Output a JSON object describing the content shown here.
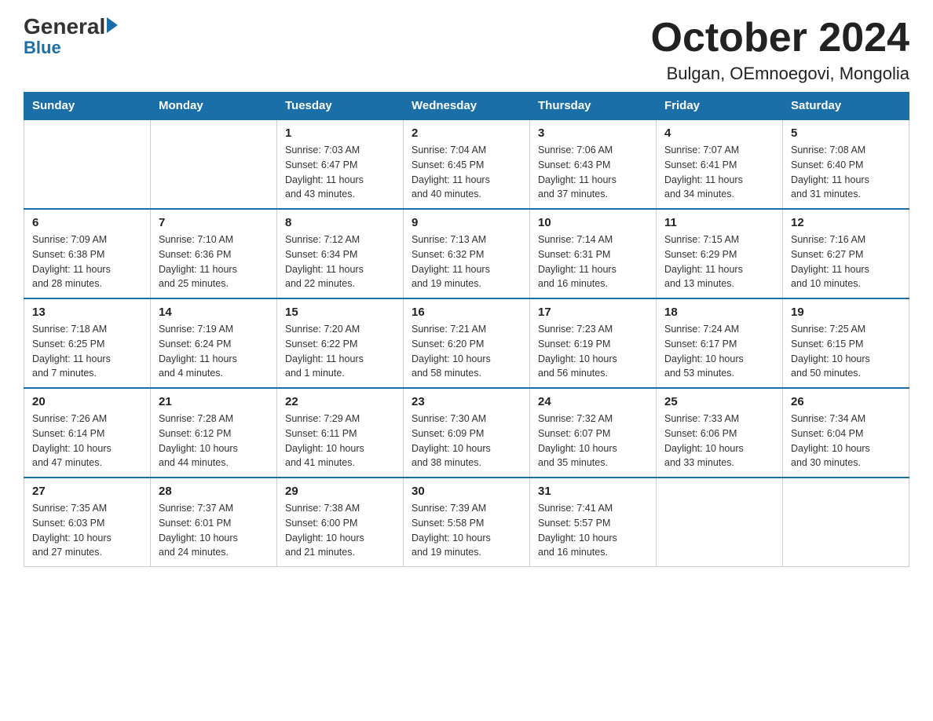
{
  "logo": {
    "general": "General",
    "blue": "Blue"
  },
  "header": {
    "title": "October 2024",
    "subtitle": "Bulgan, OEmnoegovi, Mongolia"
  },
  "days_of_week": [
    "Sunday",
    "Monday",
    "Tuesday",
    "Wednesday",
    "Thursday",
    "Friday",
    "Saturday"
  ],
  "weeks": [
    [
      {
        "day": "",
        "info": ""
      },
      {
        "day": "",
        "info": ""
      },
      {
        "day": "1",
        "info": "Sunrise: 7:03 AM\nSunset: 6:47 PM\nDaylight: 11 hours\nand 43 minutes."
      },
      {
        "day": "2",
        "info": "Sunrise: 7:04 AM\nSunset: 6:45 PM\nDaylight: 11 hours\nand 40 minutes."
      },
      {
        "day": "3",
        "info": "Sunrise: 7:06 AM\nSunset: 6:43 PM\nDaylight: 11 hours\nand 37 minutes."
      },
      {
        "day": "4",
        "info": "Sunrise: 7:07 AM\nSunset: 6:41 PM\nDaylight: 11 hours\nand 34 minutes."
      },
      {
        "day": "5",
        "info": "Sunrise: 7:08 AM\nSunset: 6:40 PM\nDaylight: 11 hours\nand 31 minutes."
      }
    ],
    [
      {
        "day": "6",
        "info": "Sunrise: 7:09 AM\nSunset: 6:38 PM\nDaylight: 11 hours\nand 28 minutes."
      },
      {
        "day": "7",
        "info": "Sunrise: 7:10 AM\nSunset: 6:36 PM\nDaylight: 11 hours\nand 25 minutes."
      },
      {
        "day": "8",
        "info": "Sunrise: 7:12 AM\nSunset: 6:34 PM\nDaylight: 11 hours\nand 22 minutes."
      },
      {
        "day": "9",
        "info": "Sunrise: 7:13 AM\nSunset: 6:32 PM\nDaylight: 11 hours\nand 19 minutes."
      },
      {
        "day": "10",
        "info": "Sunrise: 7:14 AM\nSunset: 6:31 PM\nDaylight: 11 hours\nand 16 minutes."
      },
      {
        "day": "11",
        "info": "Sunrise: 7:15 AM\nSunset: 6:29 PM\nDaylight: 11 hours\nand 13 minutes."
      },
      {
        "day": "12",
        "info": "Sunrise: 7:16 AM\nSunset: 6:27 PM\nDaylight: 11 hours\nand 10 minutes."
      }
    ],
    [
      {
        "day": "13",
        "info": "Sunrise: 7:18 AM\nSunset: 6:25 PM\nDaylight: 11 hours\nand 7 minutes."
      },
      {
        "day": "14",
        "info": "Sunrise: 7:19 AM\nSunset: 6:24 PM\nDaylight: 11 hours\nand 4 minutes."
      },
      {
        "day": "15",
        "info": "Sunrise: 7:20 AM\nSunset: 6:22 PM\nDaylight: 11 hours\nand 1 minute."
      },
      {
        "day": "16",
        "info": "Sunrise: 7:21 AM\nSunset: 6:20 PM\nDaylight: 10 hours\nand 58 minutes."
      },
      {
        "day": "17",
        "info": "Sunrise: 7:23 AM\nSunset: 6:19 PM\nDaylight: 10 hours\nand 56 minutes."
      },
      {
        "day": "18",
        "info": "Sunrise: 7:24 AM\nSunset: 6:17 PM\nDaylight: 10 hours\nand 53 minutes."
      },
      {
        "day": "19",
        "info": "Sunrise: 7:25 AM\nSunset: 6:15 PM\nDaylight: 10 hours\nand 50 minutes."
      }
    ],
    [
      {
        "day": "20",
        "info": "Sunrise: 7:26 AM\nSunset: 6:14 PM\nDaylight: 10 hours\nand 47 minutes."
      },
      {
        "day": "21",
        "info": "Sunrise: 7:28 AM\nSunset: 6:12 PM\nDaylight: 10 hours\nand 44 minutes."
      },
      {
        "day": "22",
        "info": "Sunrise: 7:29 AM\nSunset: 6:11 PM\nDaylight: 10 hours\nand 41 minutes."
      },
      {
        "day": "23",
        "info": "Sunrise: 7:30 AM\nSunset: 6:09 PM\nDaylight: 10 hours\nand 38 minutes."
      },
      {
        "day": "24",
        "info": "Sunrise: 7:32 AM\nSunset: 6:07 PM\nDaylight: 10 hours\nand 35 minutes."
      },
      {
        "day": "25",
        "info": "Sunrise: 7:33 AM\nSunset: 6:06 PM\nDaylight: 10 hours\nand 33 minutes."
      },
      {
        "day": "26",
        "info": "Sunrise: 7:34 AM\nSunset: 6:04 PM\nDaylight: 10 hours\nand 30 minutes."
      }
    ],
    [
      {
        "day": "27",
        "info": "Sunrise: 7:35 AM\nSunset: 6:03 PM\nDaylight: 10 hours\nand 27 minutes."
      },
      {
        "day": "28",
        "info": "Sunrise: 7:37 AM\nSunset: 6:01 PM\nDaylight: 10 hours\nand 24 minutes."
      },
      {
        "day": "29",
        "info": "Sunrise: 7:38 AM\nSunset: 6:00 PM\nDaylight: 10 hours\nand 21 minutes."
      },
      {
        "day": "30",
        "info": "Sunrise: 7:39 AM\nSunset: 5:58 PM\nDaylight: 10 hours\nand 19 minutes."
      },
      {
        "day": "31",
        "info": "Sunrise: 7:41 AM\nSunset: 5:57 PM\nDaylight: 10 hours\nand 16 minutes."
      },
      {
        "day": "",
        "info": ""
      },
      {
        "day": "",
        "info": ""
      }
    ]
  ]
}
